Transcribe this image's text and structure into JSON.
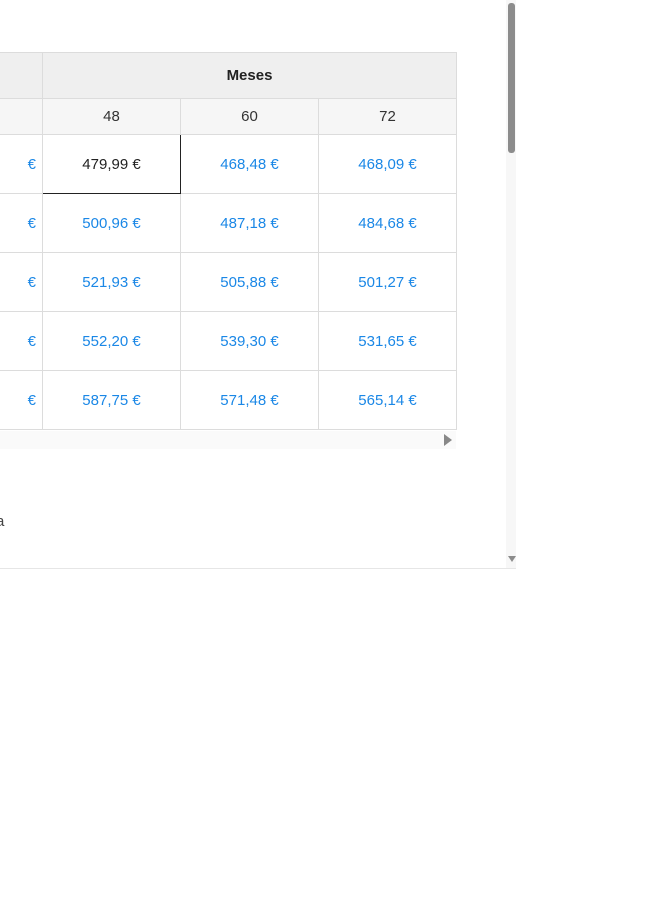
{
  "table": {
    "group_header": "Meses",
    "months": [
      "48",
      "60",
      "72"
    ],
    "rows": [
      {
        "cut": "€",
        "values": [
          "479,99 €",
          "468,48 €",
          "468,09 €"
        ]
      },
      {
        "cut": "€",
        "values": [
          "500,96 €",
          "487,18 €",
          "484,68 €"
        ]
      },
      {
        "cut": "€",
        "values": [
          "521,93 €",
          "505,88 €",
          "501,27 €"
        ]
      },
      {
        "cut": "€",
        "values": [
          "552,20 €",
          "539,30 €",
          "531,65 €"
        ]
      },
      {
        "cut": "€",
        "values": [
          "587,75 €",
          "571,48 €",
          "565,14 €"
        ]
      }
    ],
    "selected": "479,99 €"
  },
  "note_text": "a",
  "icons": {
    "scroll_right": "arrow-right-icon",
    "scroll_down": "arrow-down-icon"
  }
}
